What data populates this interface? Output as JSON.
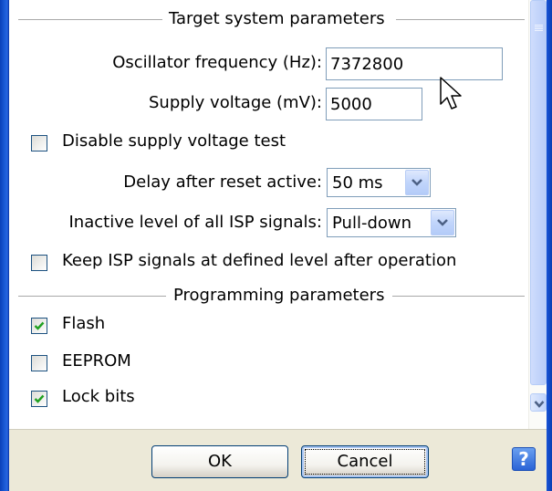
{
  "target_section": {
    "title": "Target system parameters",
    "oscillator_label": "Oscillator frequency (Hz):",
    "oscillator_value": "7372800",
    "supply_voltage_label": "Supply voltage (mV):",
    "supply_voltage_value": "5000",
    "disable_test_label": "Disable supply voltage test",
    "disable_test_checked": false,
    "delay_label": "Delay after reset active:",
    "delay_value": "50 ms",
    "inactive_level_label": "Inactive level of all ISP signals:",
    "inactive_level_value": "Pull-down",
    "keep_signals_label": "Keep ISP signals at defined level after operation",
    "keep_signals_checked": false
  },
  "programming_section": {
    "title": "Programming parameters",
    "items": [
      {
        "label": "Flash",
        "checked": true
      },
      {
        "label": "EEPROM",
        "checked": false
      },
      {
        "label": "Lock bits",
        "checked": true
      }
    ]
  },
  "buttons": {
    "ok_label": "OK",
    "cancel_label": "Cancel",
    "help_label": "?"
  },
  "colors": {
    "accent": "#0b3fb8",
    "check_green": "#21a121",
    "dialog_face": "#ece9d8"
  }
}
